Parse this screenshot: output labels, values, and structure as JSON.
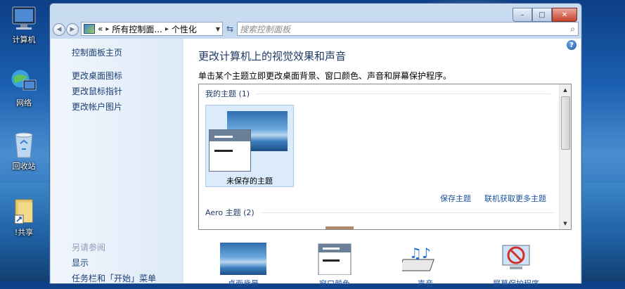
{
  "desktop": {
    "icons": [
      {
        "label": "计算机",
        "icon": "computer-icon"
      },
      {
        "label": "网络",
        "icon": "network-icon"
      },
      {
        "label": "回收站",
        "icon": "recycle-bin-icon"
      },
      {
        "label": "!共享",
        "icon": "shared-folder-icon"
      }
    ]
  },
  "window": {
    "caption_buttons": {
      "minimize": "–",
      "maximize": "□",
      "close": "✕"
    },
    "address": {
      "root_label": "«",
      "path": [
        "所有控制面...",
        "个性化"
      ],
      "separator": "▸"
    },
    "search": {
      "placeholder": "搜索控制面板"
    },
    "left_pane": {
      "home": "控制面板主页",
      "links": [
        "更改桌面图标",
        "更改鼠标指针",
        "更改帐户图片"
      ],
      "see_also_heading": "另请参阅",
      "see_also": [
        "显示",
        "任务栏和「开始」菜单"
      ]
    },
    "main": {
      "title": "更改计算机上的视觉效果和声音",
      "subtitle": "单击某个主题立即更改桌面背景、窗口颜色、声音和屏幕保护程序。",
      "groups": {
        "my_themes": "我的主题 (1)",
        "aero_themes": "Aero 主题 (2)"
      },
      "unsaved_theme_label": "未保存的主题",
      "save_theme_link": "保存主题",
      "get_more_link": "联机获取更多主题",
      "bottom_items": [
        "桌面背景",
        "窗口颜色",
        "声音",
        "屏幕保护程序"
      ]
    }
  },
  "colors": {
    "link": "#1b4f9c",
    "title": "#1e3a66",
    "selection": "#dcebfc"
  }
}
